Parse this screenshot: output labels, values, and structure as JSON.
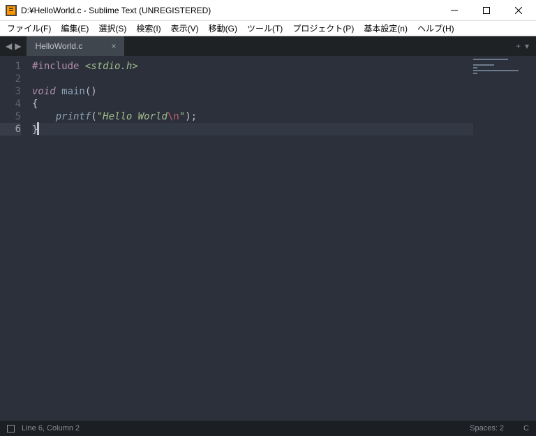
{
  "titlebar": {
    "title": "D:¥HelloWorld.c - Sublime Text (UNREGISTERED)"
  },
  "menu": {
    "file": "ファイル(F)",
    "edit": "編集(E)",
    "select": "選択(S)",
    "search": "検索(I)",
    "view": "表示(V)",
    "goto": "移動(G)",
    "tools": "ツール(T)",
    "project": "プロジェクト(P)",
    "prefs": "基本設定(n)",
    "help": "ヘルプ(H)"
  },
  "tab": {
    "name": "HelloWorld.c",
    "close": "×"
  },
  "tab_actions": {
    "plus": "+",
    "down": "▾"
  },
  "nav": {
    "left": "◀",
    "right": "▶"
  },
  "gutter": [
    "1",
    "2",
    "3",
    "4",
    "5",
    "6"
  ],
  "code": {
    "l1_include": "#include",
    "l1_header": " <stdio.h>",
    "l3_void": "void",
    "l3_main": " main",
    "l3_paren": "()",
    "l4_brace": "{",
    "l5_indent": "    ",
    "l5_printf": "printf",
    "l5_open": "(",
    "l5_str1": "\"Hello World",
    "l5_esc": "\\n",
    "l5_str2": "\"",
    "l5_close": ");",
    "l6_brace": "}"
  },
  "status": {
    "pos": "Line 6, Column 2",
    "spaces": "Spaces: 2",
    "lang": "C"
  }
}
